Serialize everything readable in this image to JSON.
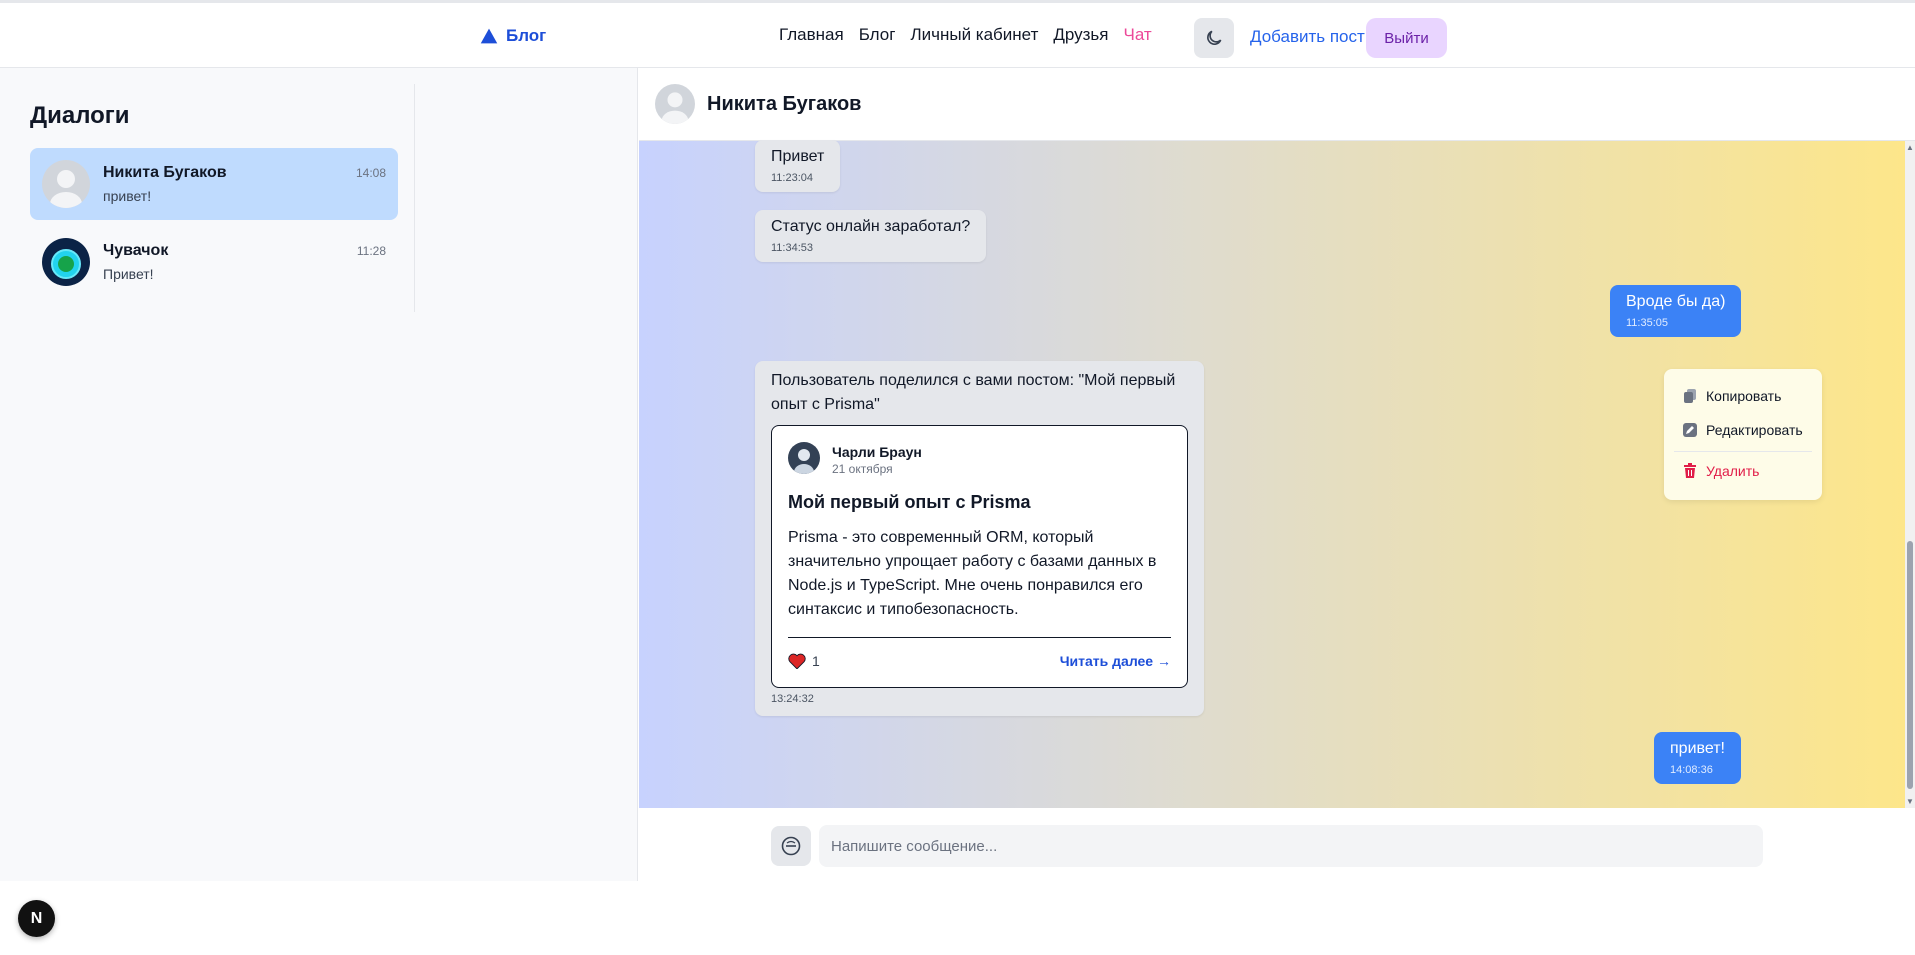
{
  "header": {
    "logo_text": "Блог",
    "nav": [
      "Главная",
      "Блог",
      "Личный кабинет",
      "Друзья",
      "Чат"
    ],
    "add_post": "Добавить пост",
    "logout": "Выйти"
  },
  "sidebar": {
    "title": "Диалоги",
    "dialogs": [
      {
        "name": "Никита Бугаков",
        "last": "привет!",
        "time": "14:08"
      },
      {
        "name": "Чувачок",
        "last": "Привет!",
        "time": "11:28"
      }
    ]
  },
  "chat": {
    "contact_name": "Никита Бугаков",
    "messages": [
      {
        "text": "Привет",
        "time": "11:23:04"
      },
      {
        "text": "Статус онлайн заработал?",
        "time": "11:34:53"
      },
      {
        "text": "Вроде бы да)",
        "time": "11:35:05"
      },
      {
        "text": "привет!",
        "time": "14:08:36"
      }
    ],
    "shared": {
      "text": "Пользователь поделился с вами постом: \"Мой первый опыт с Prisma\"",
      "time": "13:24:32",
      "card": {
        "author": "Чарли Браун",
        "date": "21 октября",
        "title": "Мой первый опыт с Prisma",
        "body": "Prisma - это современный ORM, который значительно упрощает работу с базами данных в Node.js и TypeScript. Мне очень понравился его синтаксис и типобезопасность.",
        "likes": "1",
        "read_more": "Читать далее →"
      }
    },
    "context_menu": [
      "Копировать",
      "Редактировать",
      "Удалить"
    ],
    "input_placeholder": "Напишите сообщение..."
  },
  "dev_badge": "N",
  "colors": {
    "accent": "#3b82f6",
    "active_nav": "#ec4899",
    "delete": "#e11d48"
  }
}
